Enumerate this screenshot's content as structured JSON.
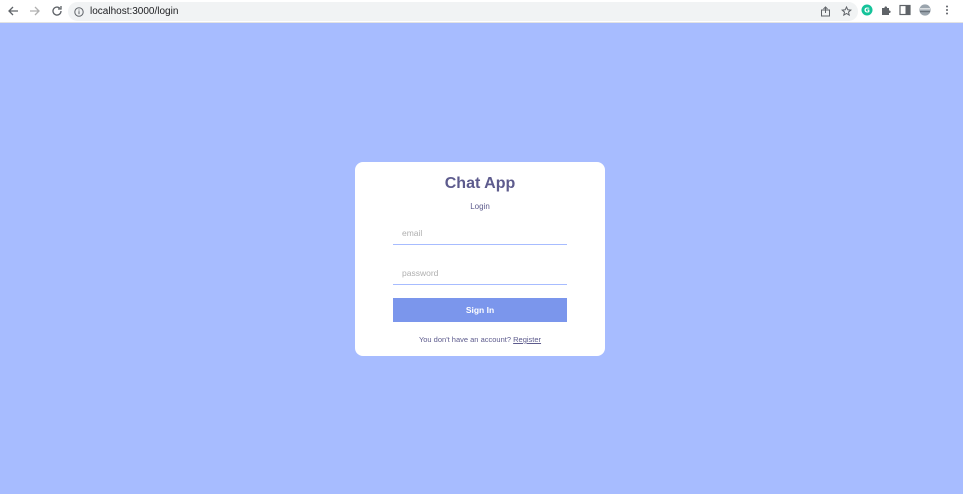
{
  "browser": {
    "url": "localhost:3000/login"
  },
  "login": {
    "title": "Chat App",
    "subtitle": "Login",
    "email_placeholder": "email",
    "password_placeholder": "password",
    "submit_label": "Sign In",
    "footer_text": "You don't have an account?",
    "register_link": "Register"
  },
  "colors": {
    "background": "#a7bcff",
    "button": "#7b96ec",
    "text": "#5d5b8d"
  }
}
